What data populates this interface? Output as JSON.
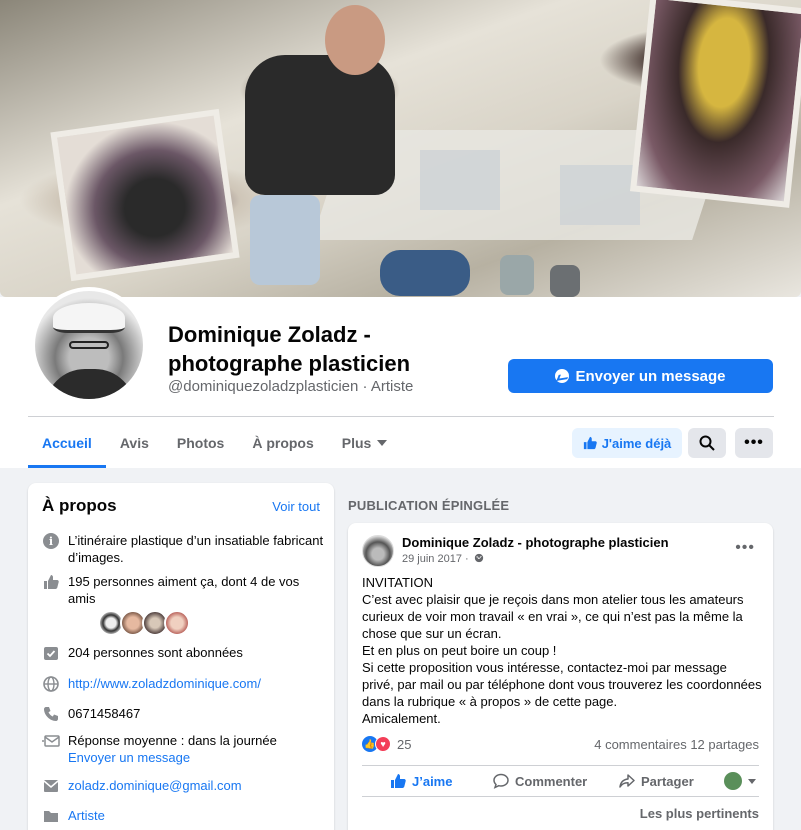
{
  "page": {
    "title": "Dominique Zoladz - photographe plasticien",
    "handle": "@dominiquezoladzplasticien · Artiste",
    "message_button": "Envoyer un message"
  },
  "tabs": [
    {
      "label": "Accueil",
      "active": true
    },
    {
      "label": "Avis"
    },
    {
      "label": "Photos"
    },
    {
      "label": "À propos"
    },
    {
      "label": "Plus"
    }
  ],
  "actions": {
    "like_button": "J'aime déjà"
  },
  "about": {
    "title": "À propos",
    "see_all": "Voir tout",
    "description": "L’itinéraire plastique d’un insatiable fabricant d’images.",
    "likes": "195 personnes aiment ça, dont 4 de vos amis",
    "followers": "204 personnes sont abonnées",
    "website": "http://www.zoladzdominique.com/",
    "phone": "0671458467",
    "response": "Réponse moyenne : dans la journée",
    "response_link": "Envoyer un message",
    "email": "zoladz.dominique@gmail.com",
    "category": "Artiste"
  },
  "pinned": {
    "label": "PUBLICATION ÉPINGLÉE",
    "author": "Dominique Zoladz - photographe plasticien",
    "date": "29 juin 2017 ·",
    "body": [
      "INVITATION",
      "C’est avec plaisir que je reçois dans mon atelier tous les amateurs curieux de voir mon travail « en vrai », ce qui n’est pas la même la chose que sur un écran.",
      "Et en plus on  peut boire un coup !",
      "Si cette proposition vous intéresse, contactez-moi par message privé, par mail ou par téléphone dont vous trouverez les coordonnées dans la rubrique « à propos » de cette page.",
      "Amicalement."
    ],
    "reaction_count": "25",
    "stats": "4 commentaires  12 partages",
    "like": "J’aime",
    "comment": "Commenter",
    "share": "Partager",
    "sort": "Les plus pertinents"
  },
  "colors": {
    "accent": "#1877f2",
    "background": "#f0f2f5",
    "secondary_text": "#65676b"
  }
}
